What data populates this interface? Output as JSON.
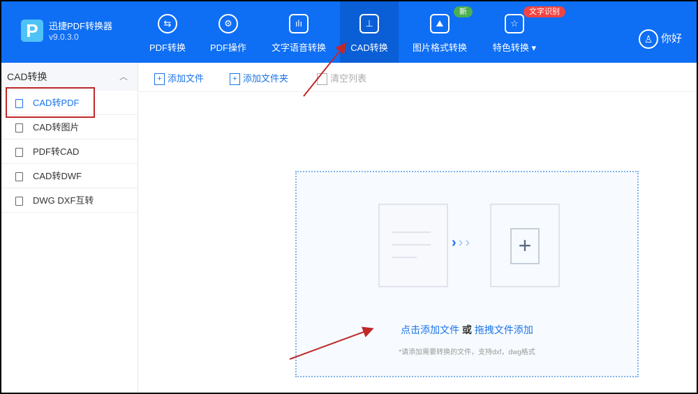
{
  "app": {
    "name": "迅捷PDF转换器",
    "version": "v9.0.3.0",
    "logo_letter": "P"
  },
  "nav": [
    {
      "label": "PDF转换",
      "icon": "⇆"
    },
    {
      "label": "PDF操作",
      "icon": "⚙"
    },
    {
      "label": "文字语音转换",
      "icon": "ılı"
    },
    {
      "label": "CAD转换",
      "icon": "⊥"
    },
    {
      "label": "图片格式转换",
      "icon": "⛰",
      "badge": "新"
    },
    {
      "label": "特色转换 ▾",
      "icon": "☆",
      "badge": "文字识别"
    }
  ],
  "user": {
    "greeting": "你好",
    "icon": "♙"
  },
  "sidebar": {
    "header": "CAD转换",
    "collapse": "︿",
    "items": [
      {
        "label": "CAD转PDF"
      },
      {
        "label": "CAD转图片"
      },
      {
        "label": "PDF转CAD"
      },
      {
        "label": "CAD转DWF"
      },
      {
        "label": "DWG DXF互转"
      }
    ]
  },
  "toolbar": {
    "add_file": "添加文件",
    "add_folder": "添加文件夹",
    "clear": "清空列表"
  },
  "drop": {
    "click_add": "点击添加文件",
    "or": "或",
    "drag_add": "拖拽文件添加",
    "hint": "*请添加需要转换的文件，支持dxf，dwg格式",
    "plus": "+",
    "chevrons": "›",
    "chevrons_faded": "››"
  },
  "colors": {
    "header": "#0e6ef4",
    "accent": "#1a73e8",
    "annotation": "#c0282a",
    "badge_new": "#4caf50",
    "badge_ocr": "#f04444"
  }
}
